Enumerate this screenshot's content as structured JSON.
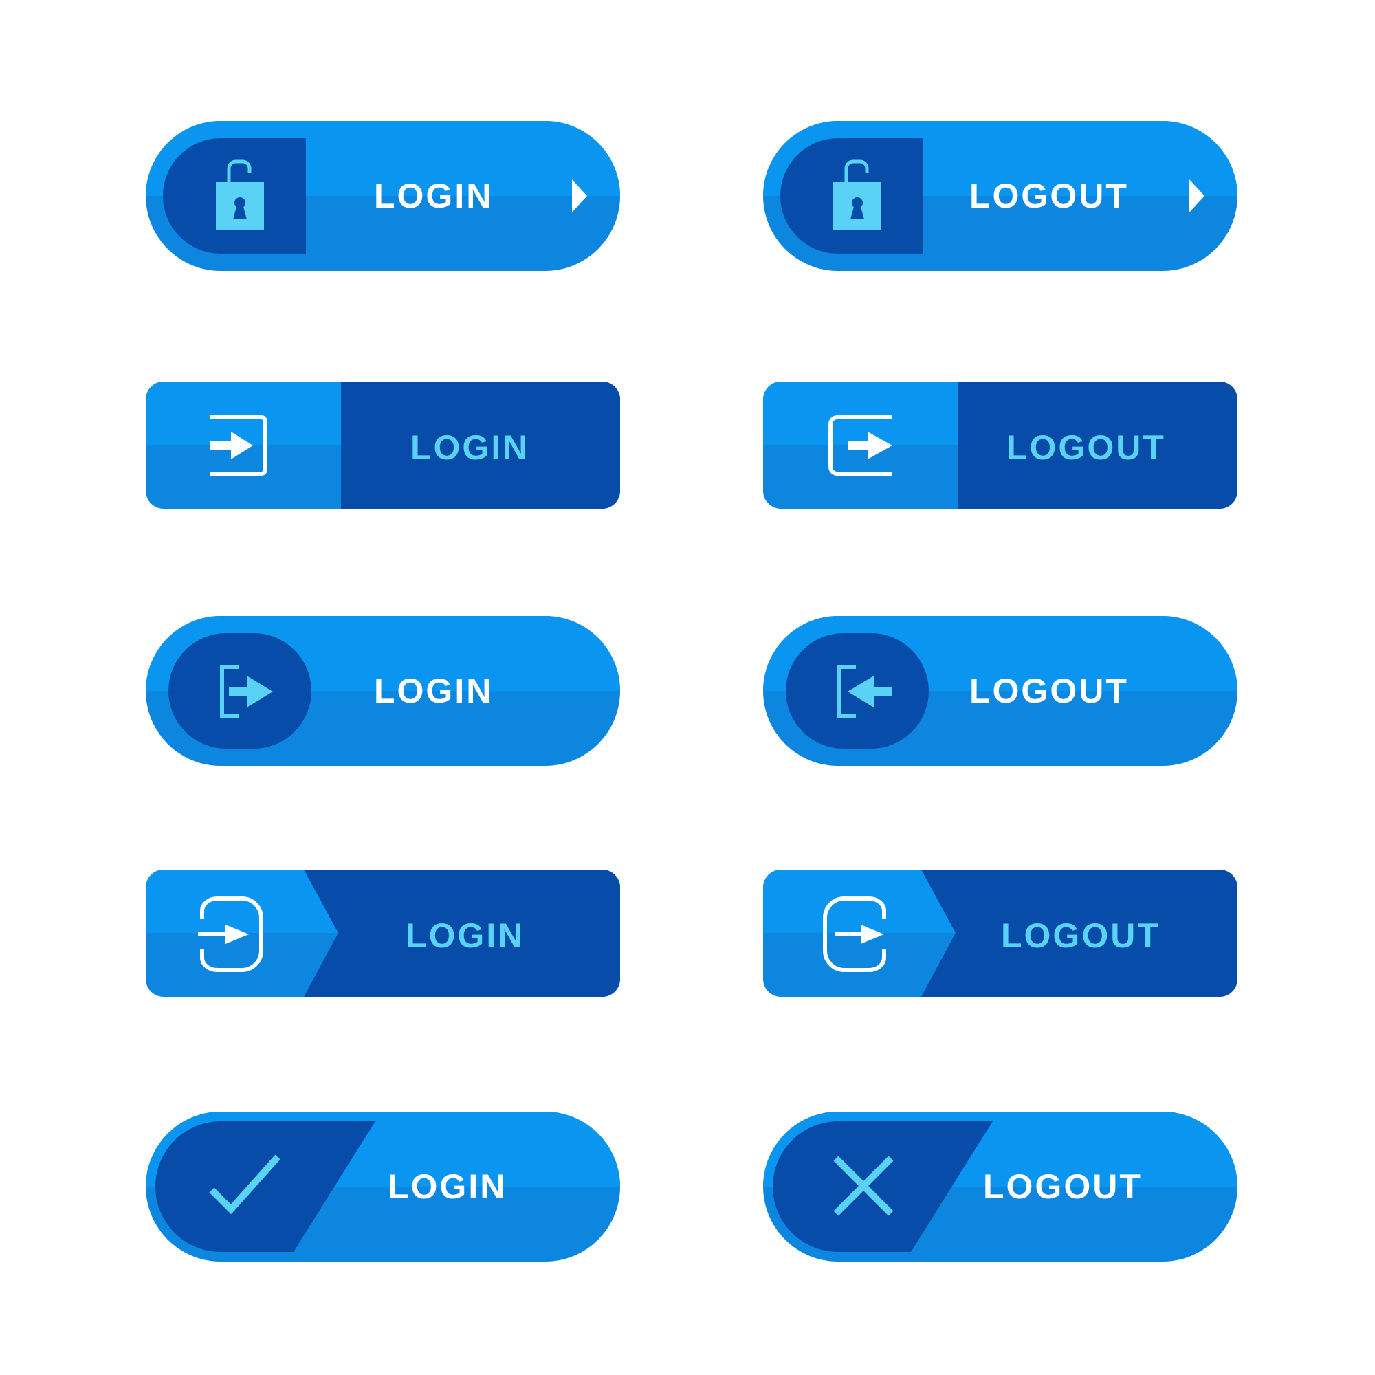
{
  "colors": {
    "light_blue": "#0a96f0",
    "mid_blue": "#0c86de",
    "dark_blue": "#064ca8",
    "cyan": "#5ad2f5",
    "white": "#ffffff"
  },
  "buttons": [
    {
      "label": "LOGIN",
      "icon": "padlock-icon"
    },
    {
      "label": "LOGOUT",
      "icon": "padlock-icon"
    },
    {
      "label": "LOGIN",
      "icon": "sign-in-icon"
    },
    {
      "label": "LOGOUT",
      "icon": "sign-out-icon"
    },
    {
      "label": "LOGIN",
      "icon": "sign-in-icon"
    },
    {
      "label": "LOGOUT",
      "icon": "sign-out-icon"
    },
    {
      "label": "LOGIN",
      "icon": "enter-door-icon"
    },
    {
      "label": "LOGOUT",
      "icon": "exit-door-icon"
    },
    {
      "label": "LOGIN",
      "icon": "checkmark-icon"
    },
    {
      "label": "LOGOUT",
      "icon": "x-mark-icon"
    }
  ]
}
